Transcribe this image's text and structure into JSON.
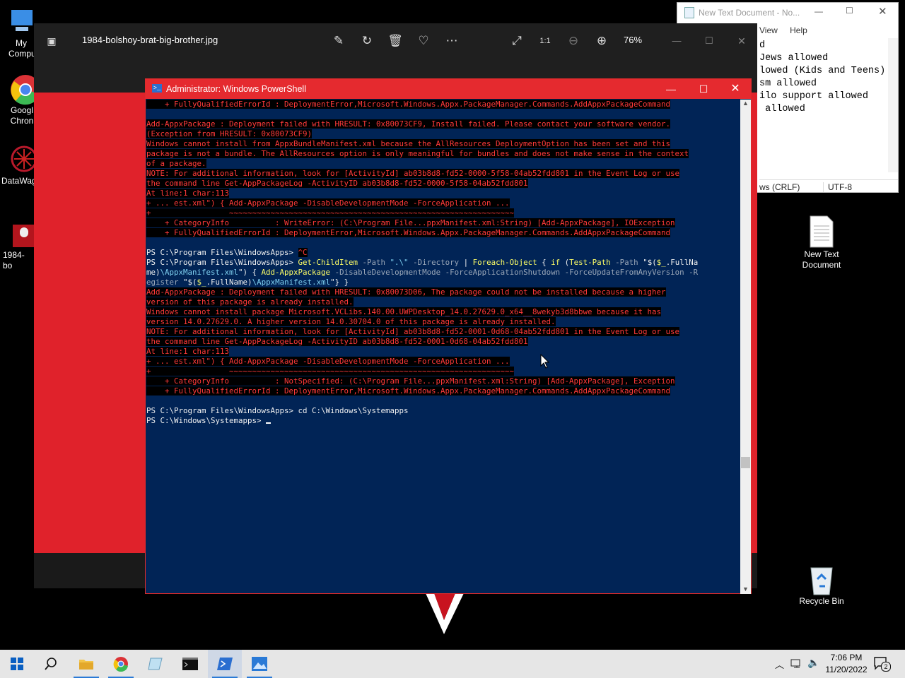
{
  "desktop": {
    "icons": [
      {
        "label": "My\nComputer",
        "visible": "My\nCompu"
      },
      {
        "label": "Google Chrome",
        "visible": "Googl\nChron"
      },
      {
        "label": "DataWag",
        "visible": "DataWag"
      },
      {
        "label": "1984-bo",
        "visible": "1984-bo"
      },
      {
        "label": "New Text\nDocument"
      },
      {
        "label": "Recycle Bin"
      }
    ]
  },
  "notepad": {
    "title": "New Text Document - No...",
    "menu": [
      "View",
      "Help"
    ],
    "lines": [
      "d",
      "Jews allowed",
      "lowed (Kids and Teens)",
      "sm allowed",
      "ilo support allowed",
      " allowed"
    ],
    "status_eol": "ws (CRLF)",
    "status_enc": "UTF-8"
  },
  "photos": {
    "filename": "1984-bolshoy-brat-big-brother.jpg",
    "zoom": "76%",
    "toolbar_icons": [
      "edit-icon",
      "rotate-icon",
      "delete-icon",
      "favorite-icon",
      "more-icon",
      "fullscreen-icon",
      "actual-size-icon",
      "zoom-out-icon",
      "zoom-in-icon"
    ]
  },
  "powershell": {
    "title": "Administrator: Windows PowerShell",
    "lines": [
      {
        "t": "err",
        "text": "    + FullyQualifiedErrorId : DeploymentError,Microsoft.Windows.Appx.PackageManager.Commands.AddAppxPackageCommand"
      },
      {
        "t": "blank",
        "text": ""
      },
      {
        "t": "err",
        "text": "Add-AppxPackage : Deployment failed with HRESULT: 0x80073CF9, Install failed. Please contact your software vendor."
      },
      {
        "t": "err",
        "text": "(Exception from HRESULT: 0x80073CF9)"
      },
      {
        "t": "err",
        "text": "Windows cannot install from AppxBundleManifest.xml because the AllResources DeploymentOption has been set and this"
      },
      {
        "t": "err",
        "text": "package is not a bundle. The AllResources option is only meaningful for bundles and does not make sense in the context"
      },
      {
        "t": "err",
        "text": "of a package."
      },
      {
        "t": "err",
        "text": "NOTE: For additional information, look for [ActivityId] ab03b8d8-fd52-0000-5f58-04ab52fdd801 in the Event Log or use"
      },
      {
        "t": "err",
        "text": "the command line Get-AppPackageLog -ActivityID ab03b8d8-fd52-0000-5f58-04ab52fdd801"
      },
      {
        "t": "err",
        "text": "At line:1 char:113"
      },
      {
        "t": "err",
        "text": "+ ... est.xml\") { Add-AppxPackage -DisableDevelopmentMode -ForceApplication ..."
      },
      {
        "t": "err",
        "text": "+                 ~~~~~~~~~~~~~~~~~~~~~~~~~~~~~~~~~~~~~~~~~~~~~~~~~~~~~~~~~~~~~~"
      },
      {
        "t": "err",
        "text": "    + CategoryInfo          : WriteError: (C:\\Program File...ppxManifest.xml:String) [Add-AppxPackage], IOException"
      },
      {
        "t": "err",
        "text": "    + FullyQualifiedErrorId : DeploymentError,Microsoft.Windows.Appx.PackageManager.Commands.AddAppxPackageCommand"
      },
      {
        "t": "blank",
        "text": ""
      },
      {
        "t": "ctrlc",
        "text": "PS C:\\Program Files\\WindowsApps> ",
        "extra": "^C"
      },
      {
        "t": "cmd1",
        "text": ""
      },
      {
        "t": "cmd2",
        "text": ""
      },
      {
        "t": "cmd3",
        "text": ""
      },
      {
        "t": "err",
        "text": "Add-AppxPackage : Deployment failed with HRESULT: 0x80073D06, The package could not be installed because a higher"
      },
      {
        "t": "err",
        "text": "version of this package is already installed."
      },
      {
        "t": "err",
        "text": "Windows cannot install package Microsoft.VCLibs.140.00.UWPDesktop_14.0.27629.0_x64__8wekyb3d8bbwe because it has"
      },
      {
        "t": "err",
        "text": "version 14.0.27629.0. A higher version 14.0.30704.0 of this package is already installed."
      },
      {
        "t": "err",
        "text": "NOTE: For additional information, look for [ActivityId] ab03b8d8-fd52-0001-0d68-04ab52fdd801 in the Event Log or use"
      },
      {
        "t": "err",
        "text": "the command line Get-AppPackageLog -ActivityID ab03b8d8-fd52-0001-0d68-04ab52fdd801"
      },
      {
        "t": "err",
        "text": "At line:1 char:113"
      },
      {
        "t": "err",
        "text": "+ ... est.xml\") { Add-AppxPackage -DisableDevelopmentMode -ForceApplication ..."
      },
      {
        "t": "err",
        "text": "+                 ~~~~~~~~~~~~~~~~~~~~~~~~~~~~~~~~~~~~~~~~~~~~~~~~~~~~~~~~~~~~~~"
      },
      {
        "t": "err",
        "text": "    + CategoryInfo          : NotSpecified: (C:\\Program File...ppxManifest.xml:String) [Add-AppxPackage], Exception"
      },
      {
        "t": "err",
        "text": "    + FullyQualifiedErrorId : DeploymentError,Microsoft.Windows.Appx.PackageManager.Commands.AddAppxPackageCommand"
      },
      {
        "t": "blank",
        "text": ""
      },
      {
        "t": "plain",
        "text": "PS C:\\Program Files\\WindowsApps> cd C:\\Windows\\Systemapps"
      },
      {
        "t": "prompt",
        "text": "PS C:\\Windows\\Systemapps> "
      }
    ],
    "cmd_parts": {
      "l1": [
        [
          "plain",
          "PS C:\\Program Files\\WindowsApps> "
        ],
        [
          "cmd",
          "Get-ChildItem"
        ],
        [
          "prm",
          " -Path "
        ],
        [
          "str",
          "\".\\\""
        ],
        [
          "prm",
          " -Directory"
        ],
        [
          "plain",
          " | "
        ],
        [
          "cmd",
          "Foreach-Object"
        ],
        [
          "plain",
          " { "
        ],
        [
          "cmd",
          "if"
        ],
        [
          "plain",
          " ("
        ],
        [
          "cmd",
          "Test-Path"
        ],
        [
          "prm",
          " -Path "
        ],
        [
          "plain",
          "\"$("
        ],
        [
          "cmd",
          "$_"
        ],
        [
          "plain",
          ".FullNa"
        ]
      ],
      "l2": [
        [
          "plain",
          "me)"
        ],
        [
          "str",
          "\\AppxManifest.xml"
        ],
        [
          "plain",
          "\") { "
        ],
        [
          "cmd",
          "Add-AppxPackage"
        ],
        [
          "prm",
          " -DisableDevelopmentMode -ForceApplicationShutdown -ForceUpdateFromAnyVersion -R"
        ]
      ],
      "l3": [
        [
          "prm",
          "egister "
        ],
        [
          "plain",
          "\"$("
        ],
        [
          "cmd",
          "$_"
        ],
        [
          "plain",
          ".FullName)"
        ],
        [
          "str",
          "\\AppxManifest.xml"
        ],
        [
          "plain",
          "\"} }"
        ]
      ]
    }
  },
  "taskbar": {
    "time": "7:06 PM",
    "date": "11/20/2022",
    "notification_count": "2",
    "apps": [
      "windows-start",
      "search",
      "file-explorer",
      "chrome",
      "notepad",
      "cmd",
      "powershell",
      "photos"
    ]
  },
  "colors": {
    "ps_bg": "#012456",
    "ps_title": "#e52a2f",
    "error": "#ff3a3a",
    "image_red": "#e0222b"
  }
}
